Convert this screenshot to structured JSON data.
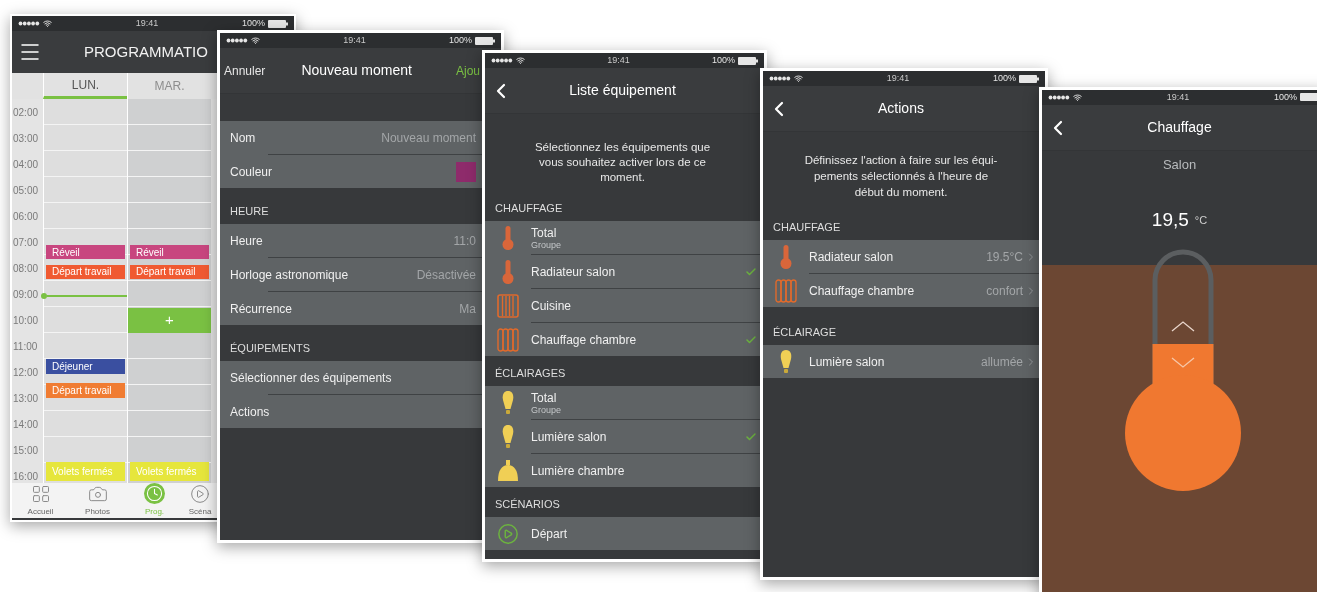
{
  "screens": [
    {
      "kind": "calendar",
      "status_bar": {
        "time": "19:41",
        "battery": "100%"
      },
      "title": "PROGRAMMATIO",
      "days": [
        {
          "label": "LUN.",
          "selected": true,
          "events": [
            {
              "kind": "event",
              "label": "Réveil",
              "color": "#c8467f"
            },
            {
              "kind": "event",
              "label": "Départ travail",
              "color": "#f05a32"
            },
            {
              "kind": "event",
              "label": "Déjeuner",
              "color": "#3a4fa0"
            },
            {
              "kind": "event",
              "label": "Départ travail",
              "color": "#f07c32"
            },
            {
              "kind": "event",
              "label": "Volets fermés",
              "color": "#e6e63c"
            }
          ]
        },
        {
          "label": "MAR.",
          "selected": false,
          "events": [
            {
              "kind": "event",
              "label": "Réveil",
              "color": "#c8467f"
            },
            {
              "kind": "event",
              "label": "Départ travail",
              "color": "#f05a32"
            },
            {
              "kind": "add",
              "label": "+",
              "color": "#7ac143"
            },
            {
              "kind": "event",
              "label": "Volets fermés",
              "color": "#e6e63c"
            }
          ]
        }
      ],
      "hours": [
        "02:00",
        "03:00",
        "04:00",
        "05:00",
        "06:00",
        "07:00",
        "08:00",
        "09:00",
        "10:00",
        "11:00",
        "12:00",
        "13:00",
        "14:00",
        "15:00",
        "16:00"
      ],
      "tab_bar": [
        {
          "label": "Accueil",
          "kind": "grid",
          "selected": false
        },
        {
          "label": "Photos",
          "kind": "camera",
          "selected": false
        },
        {
          "label": "Prog.",
          "kind": "clock",
          "selected": true
        },
        {
          "label": "Scéna",
          "kind": "play",
          "selected": false
        }
      ]
    },
    {
      "kind": "form",
      "status_bar": {
        "time": "19:41",
        "battery": "100%"
      },
      "nav": {
        "cancel": "Annuler",
        "title": "Nouveau moment",
        "confirm": "Ajou"
      },
      "sections": [
        {
          "rows": [
            {
              "label": "Nom",
              "value": "Nouveau moment"
            },
            {
              "label": "Couleur",
              "color": "#8e2b6b"
            }
          ]
        },
        {
          "header": "HEURE",
          "rows": [
            {
              "label": "Heure",
              "value": "11:0"
            },
            {
              "label": "Horloge astronomique",
              "value": "Désactivée"
            },
            {
              "label": "Récurrence",
              "value": "Ma"
            }
          ]
        },
        {
          "header": "ÉQUIPEMENTS",
          "rows": [
            {
              "label": "Sélectionner des équipements"
            },
            {
              "label": "Actions"
            }
          ]
        }
      ]
    },
    {
      "kind": "equipment_list",
      "status_bar": {
        "time": "19:41",
        "battery": "100%"
      },
      "title": "Liste équipement",
      "description": "Sélectionnez les équipements que vous souhaitez activer lors de ce moment.",
      "sections": [
        {
          "header": "CHAUFFAGE",
          "items": [
            {
              "kind": "thermometer",
              "label": "Total",
              "sublabel": "Groupe",
              "checked": false
            },
            {
              "kind": "thermometer",
              "label": "Radiateur salon",
              "checked": true
            },
            {
              "kind": "radiator",
              "label": "Cuisine",
              "checked": false
            },
            {
              "kind": "radiator-rounded",
              "label": "Chauffage chambre",
              "checked": true
            }
          ]
        },
        {
          "header": "ÉCLAIRAGES",
          "items": [
            {
              "kind": "bulb",
              "label": "Total",
              "sublabel": "Groupe",
              "checked": false
            },
            {
              "kind": "bulb",
              "label": "Lumière salon",
              "checked": true
            },
            {
              "kind": "lamp",
              "label": "Lumière chambre",
              "checked": false
            }
          ]
        },
        {
          "header": "SCÉNARIOS",
          "items": [
            {
              "kind": "play",
              "label": "Départ",
              "checked": false
            }
          ]
        }
      ]
    },
    {
      "kind": "actions",
      "status_bar": {
        "time": "19:41",
        "battery": "100%"
      },
      "title": "Actions",
      "description": "Définissez l'action à faire sur les équi-pements sélectionnés à l'heure de début du moment.",
      "sections": [
        {
          "header": "CHAUFFAGE",
          "items": [
            {
              "kind": "thermometer",
              "label": "Radiateur salon",
              "value": "19.5°C"
            },
            {
              "kind": "radiator-rounded",
              "label": "Chauffage chambre",
              "value": "confort"
            }
          ]
        },
        {
          "header": "ÉCLAIRAGE",
          "items": [
            {
              "kind": "bulb",
              "label": "Lumière salon",
              "value": "allumée"
            }
          ]
        }
      ]
    },
    {
      "kind": "thermostat",
      "status_bar": {
        "time": "19:41",
        "battery": "100%"
      },
      "title": "Chauffage",
      "room": "Salon",
      "temperature": "19,5",
      "unit": "°C"
    }
  ]
}
